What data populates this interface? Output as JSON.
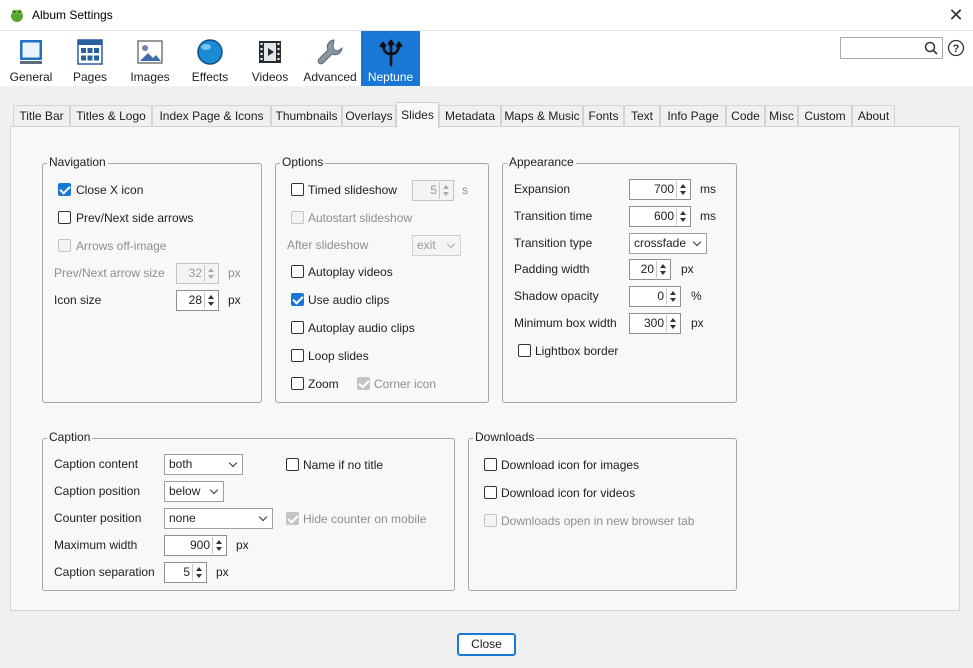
{
  "window": {
    "title": "Album Settings",
    "close_icon": "close-icon",
    "app_icon": "frog-app-icon"
  },
  "toolbar": {
    "items": [
      {
        "label": "General",
        "icon": "monitor-icon"
      },
      {
        "label": "Pages",
        "icon": "pages-grid-icon"
      },
      {
        "label": "Images",
        "icon": "image-icon"
      },
      {
        "label": "Effects",
        "icon": "sphere-icon"
      },
      {
        "label": "Videos",
        "icon": "film-icon"
      },
      {
        "label": "Advanced",
        "icon": "wrench-icon"
      },
      {
        "label": "Neptune",
        "icon": "trident-icon",
        "active": true
      }
    ],
    "search": {
      "value": "",
      "placeholder": ""
    }
  },
  "tabs": {
    "items": [
      "Title Bar",
      "Titles & Logo",
      "Index Page & Icons",
      "Thumbnails",
      "Overlays",
      "Slides",
      "Metadata",
      "Maps & Music",
      "Fonts",
      "Text",
      "Info Page",
      "Code",
      "Misc",
      "Custom",
      "About"
    ],
    "active": "Slides"
  },
  "navigation": {
    "title": "Navigation",
    "close_x": {
      "label": "Close X icon",
      "checked": true
    },
    "side_arrows": {
      "label": "Prev/Next side arrows",
      "checked": false
    },
    "arrows_off": {
      "label": "Arrows off-image",
      "checked": false,
      "disabled": true
    },
    "arrow_size": {
      "label": "Prev/Next arrow size",
      "value": "32",
      "unit": "px",
      "disabled": true
    },
    "icon_size": {
      "label": "Icon size",
      "value": "28",
      "unit": "px"
    }
  },
  "options": {
    "title": "Options",
    "timed": {
      "label": "Timed slideshow",
      "checked": false,
      "value": "5",
      "unit": "s"
    },
    "autostart": {
      "label": "Autostart slideshow",
      "checked": false,
      "disabled": true
    },
    "after": {
      "label": "After slideshow",
      "value": "exit",
      "disabled": true
    },
    "autoplay_videos": {
      "label": "Autoplay videos",
      "checked": false
    },
    "audio_clips": {
      "label": "Use audio clips",
      "checked": true
    },
    "autoplay_audio": {
      "label": "Autoplay audio clips",
      "checked": false
    },
    "loop": {
      "label": "Loop slides",
      "checked": false
    },
    "zoom": {
      "label": "Zoom",
      "checked": false
    },
    "corner": {
      "label": "Corner icon",
      "checked": true,
      "disabled": true
    }
  },
  "appearance": {
    "title": "Appearance",
    "expansion": {
      "label": "Expansion",
      "value": "700",
      "unit": "ms"
    },
    "transition_time": {
      "label": "Transition time",
      "value": "600",
      "unit": "ms"
    },
    "transition_type": {
      "label": "Transition type",
      "value": "crossfade"
    },
    "padding": {
      "label": "Padding width",
      "value": "20",
      "unit": "px"
    },
    "shadow": {
      "label": "Shadow opacity",
      "value": "0",
      "unit": "%"
    },
    "min_box": {
      "label": "Minimum box width",
      "value": "300",
      "unit": "px"
    },
    "lightbox_border": {
      "label": "Lightbox border",
      "checked": false
    }
  },
  "caption": {
    "title": "Caption",
    "content": {
      "label": "Caption content",
      "value": "both"
    },
    "position": {
      "label": "Caption position",
      "value": "below"
    },
    "counter": {
      "label": "Counter position",
      "value": "none"
    },
    "max_width": {
      "label": "Maximum width",
      "value": "900",
      "unit": "px"
    },
    "separation": {
      "label": "Caption separation",
      "value": "5",
      "unit": "px"
    },
    "name_if_no_title": {
      "label": "Name if no title",
      "checked": false
    },
    "hide_counter": {
      "label": "Hide counter on mobile",
      "checked": true,
      "disabled": true
    }
  },
  "downloads": {
    "title": "Downloads",
    "images": {
      "label": "Download icon for images",
      "checked": false
    },
    "videos": {
      "label": "Download icon for videos",
      "checked": false
    },
    "new_tab": {
      "label": "Downloads open in new browser tab",
      "checked": false,
      "disabled": true
    }
  },
  "footer": {
    "close_label": "Close"
  },
  "colors": {
    "accent": "#1978d6"
  }
}
